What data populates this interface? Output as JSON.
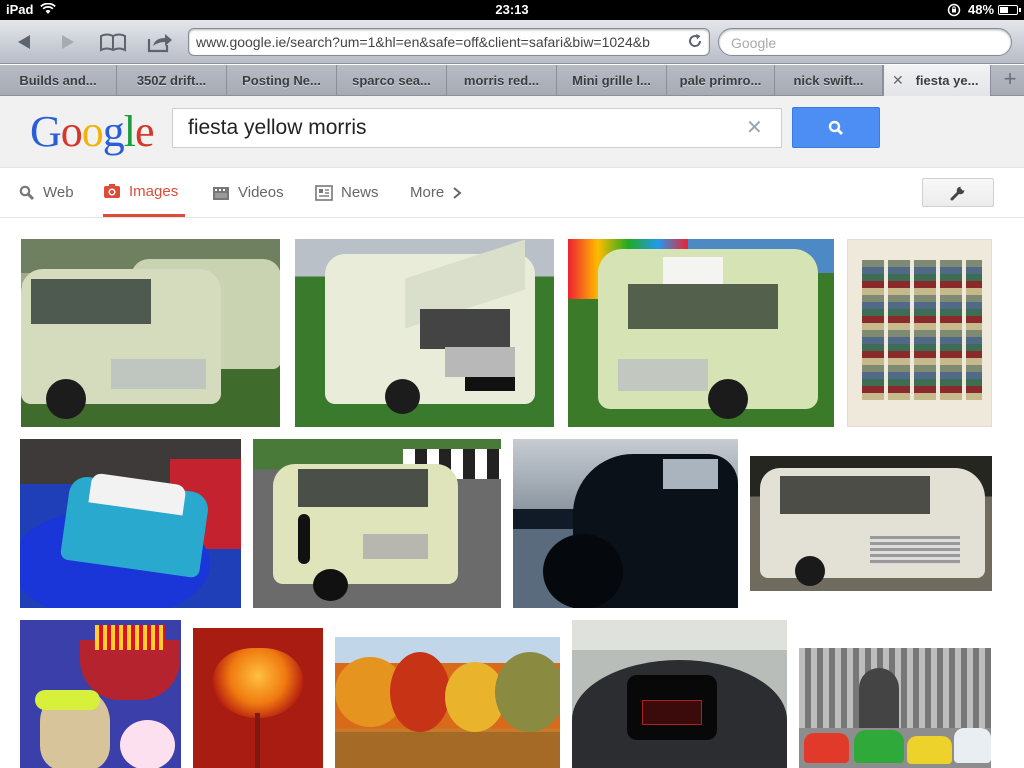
{
  "status": {
    "carrier": "iPad",
    "time": "23:13",
    "battery": "48%",
    "battery_fraction": 0.48
  },
  "toolbar": {
    "url": "www.google.ie/search?um=1&hl=en&safe=off&client=safari&biw=1024&b",
    "search_placeholder": "Google"
  },
  "tabs": [
    "Builds and...",
    "350Z drift...",
    "Posting Ne...",
    "sparco sea...",
    "morris red...",
    "Mini grille l...",
    "pale primro...",
    "nick swift...",
    "fiesta ye..."
  ],
  "active_tab": 8,
  "google": {
    "logo_letters": [
      "G",
      "o",
      "o",
      "g",
      "l",
      "e"
    ],
    "logo_colors": [
      "#2a5ed8",
      "#d6362b",
      "#f0b20b",
      "#2a5ed8",
      "#1c9b3c",
      "#d6362b"
    ],
    "query": "fiesta yellow morris"
  },
  "nav": {
    "web": "Web",
    "images": "Images",
    "videos": "Videos",
    "news": "News",
    "more": "More"
  },
  "colors": {
    "accent": "#dd4b39",
    "search_button": "#4c8ef3"
  }
}
